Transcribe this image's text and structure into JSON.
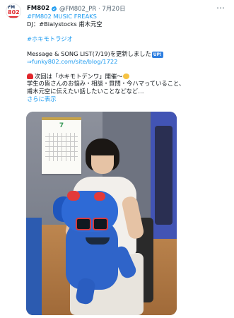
{
  "tweet": {
    "author_name": "FM802",
    "handle_time": "@FM802_PR · 7月20日",
    "avatar": {
      "logo_top": "FM",
      "logo_num": "802"
    },
    "lines": [
      "#FM802 MUSIC FREAKS",
      "DJ：#Bialystocks 甫木元空",
      "",
      "#ホキモトラジオ",
      "",
      "Message & SONG LIST(7/19)を更新しました",
      "⇒funky802.com/site/blog/1722",
      "",
      "次回は「ホキモトデンワ」開催〜",
      "学生の皆さんのお悩み・相談・質問・今ハマっていること、",
      "甫木元空に伝えたい話したいことなどなど…",
      "さらに表示"
    ],
    "up_badge": "UP!",
    "calendar_month": "7"
  },
  "colors": {
    "link": "#1d9bf0",
    "text": "#0f1419",
    "secondary": "#536471",
    "verified": "#1d9bf0"
  },
  "icons": {
    "verified": "verified-badge-icon",
    "more": "more-options-icon",
    "alarm": "siren-emoji",
    "sweat": "sweat-smile-emoji",
    "up": "up-button-emoji"
  }
}
